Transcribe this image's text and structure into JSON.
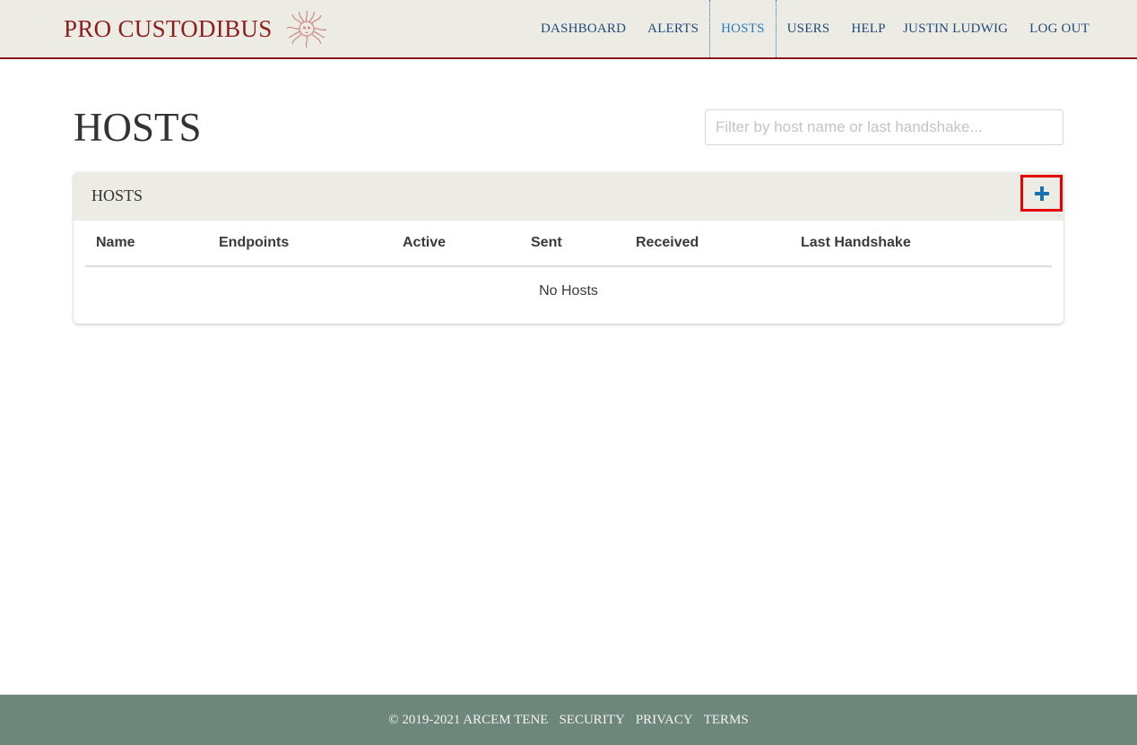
{
  "brand": {
    "name": "PRO CUSTODIBUS",
    "logo_icon": "medusa-head-logo",
    "color": "#8b1f1f"
  },
  "nav": {
    "main": [
      {
        "label": "DASHBOARD",
        "active": false
      },
      {
        "label": "ALERTS",
        "active": false
      },
      {
        "label": "HOSTS",
        "active": true
      },
      {
        "label": "USERS",
        "active": false
      },
      {
        "label": "HELP",
        "active": false
      }
    ],
    "user": [
      {
        "label": "JUSTIN LUDWIG"
      },
      {
        "label": "LOG OUT"
      }
    ]
  },
  "page": {
    "title": "HOSTS",
    "filter_placeholder": "Filter by host name or last handshake...",
    "filter_value": ""
  },
  "panel": {
    "title": "HOSTS",
    "add_icon": "plus-icon",
    "columns": [
      "Name",
      "Endpoints",
      "Active",
      "Sent",
      "Received",
      "Last Handshake"
    ],
    "rows": [],
    "empty_message": "No Hosts"
  },
  "footer": {
    "copyright": "© 2019-2021 ARCEM TENE",
    "links": [
      "SECURITY",
      "PRIVACY",
      "TERMS"
    ]
  },
  "colors": {
    "header_bg": "#edece4",
    "header_border": "#8b1a1a",
    "nav_text": "#1f4a7a",
    "nav_active": "#2a7ab8",
    "footer_bg": "#6e877c",
    "add_button_highlight": "#e60000"
  }
}
